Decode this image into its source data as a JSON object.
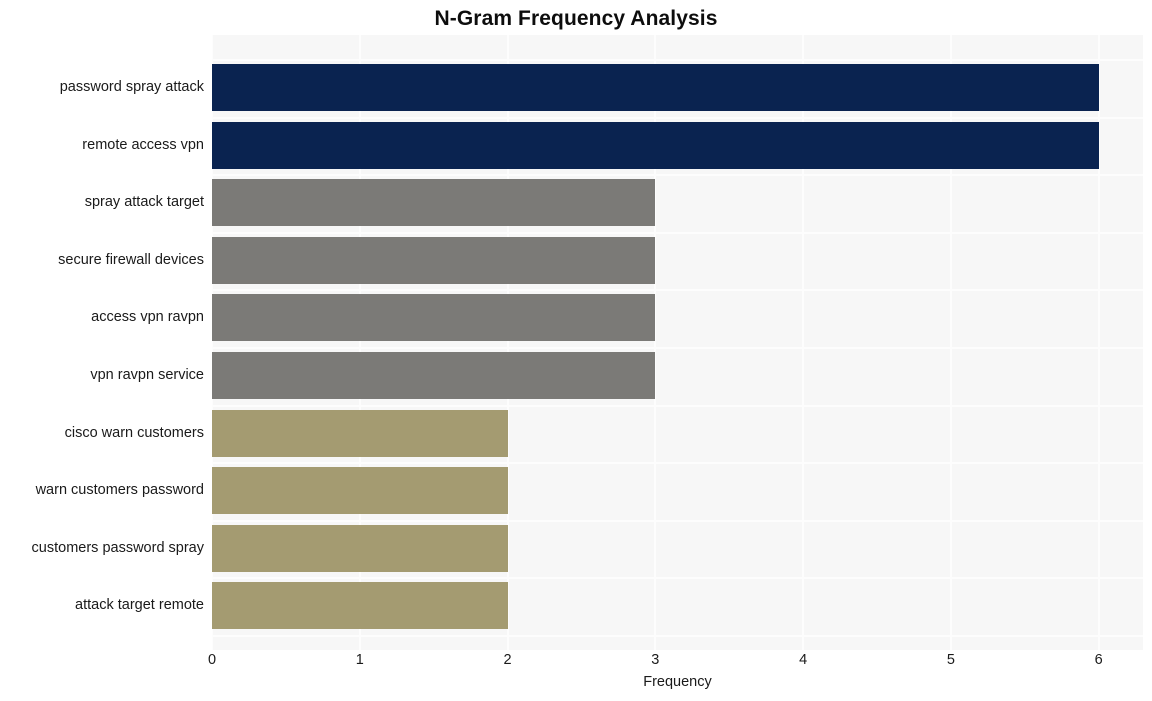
{
  "chart_data": {
    "type": "bar",
    "orientation": "horizontal",
    "title": "N-Gram Frequency Analysis",
    "xlabel": "Frequency",
    "ylabel": "",
    "xlim": [
      0,
      6.3
    ],
    "xticks": [
      "0",
      "1",
      "2",
      "3",
      "4",
      "5",
      "6"
    ],
    "xtick_values": [
      0,
      1,
      2,
      3,
      4,
      5,
      6
    ],
    "grid": true,
    "legend": false,
    "categories": [
      "password spray attack",
      "remote access vpn",
      "spray attack target",
      "secure firewall devices",
      "access vpn ravpn",
      "vpn ravpn service",
      "cisco warn customers",
      "warn customers password",
      "customers password spray",
      "attack target remote"
    ],
    "values": [
      6,
      6,
      3,
      3,
      3,
      3,
      2,
      2,
      2,
      2
    ],
    "bar_colors": [
      "#0a2350",
      "#0a2350",
      "#7b7a77",
      "#7b7a77",
      "#7b7a77",
      "#7b7a77",
      "#a49b71",
      "#a49b71",
      "#a49b71",
      "#a49b71"
    ]
  },
  "style": {
    "figure_background": "#ffffff",
    "plot_background": "#f7f7f7",
    "gridline_color": "#fdfdfd",
    "title_color": "#0d0d0d",
    "tick_label_color": "#1a1a1a"
  }
}
